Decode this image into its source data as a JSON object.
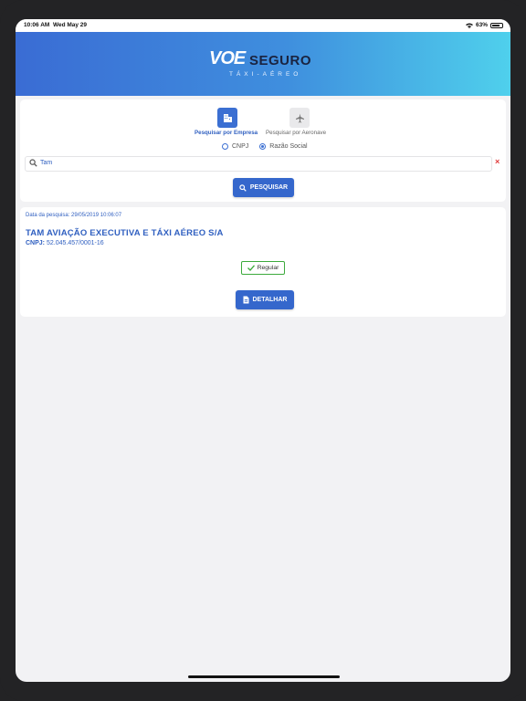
{
  "status_bar": {
    "time": "10:06 AM",
    "date": "Wed May 29",
    "battery": "63%"
  },
  "brand": {
    "logo_mark": "VOE",
    "logo_word": "SEGURO",
    "logo_sub": "TÁXI-AÉREO"
  },
  "search": {
    "modes": [
      {
        "label": "Pesquisar por Empresa",
        "icon": "building-icon",
        "selected": true
      },
      {
        "label": "Pesquisar por Aeronave",
        "icon": "airplane-icon",
        "selected": false
      }
    ],
    "radio_options": [
      {
        "label": "CNPJ",
        "selected": false
      },
      {
        "label": "Razão Social",
        "selected": true
      }
    ],
    "query": "Tam",
    "search_button": "PESQUISAR"
  },
  "result": {
    "date_label": "Data da pesquisa: 29/05/2019 10:06:07",
    "company_name": "TAM AVIAÇÃO EXECUTIVA E TÁXI AÉREO S/A",
    "cnpj_label": "CNPJ:",
    "cnpj_value": "52.045.457/0001-16",
    "status": "Regular",
    "detail_button": "DETALHAR"
  },
  "colors": {
    "accent": "#3567cc",
    "header_start": "#3a6cd4",
    "header_end": "#4fd0ec",
    "status_ok": "#3caa3c",
    "clear": "#e03a3a"
  }
}
